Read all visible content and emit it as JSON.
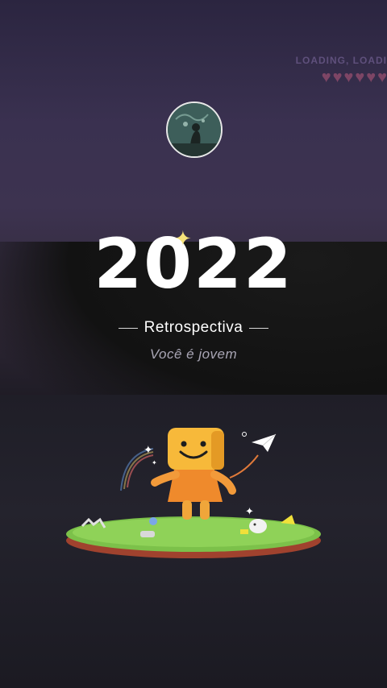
{
  "header": {
    "loading_text": "LOADING, LOADI",
    "hearts": [
      "♥",
      "♥",
      "♥",
      "♥",
      "♥",
      "♥"
    ]
  },
  "hero": {
    "year": "2022",
    "title": "Retrospectiva",
    "tagline": "Você é jovem"
  },
  "icons": {
    "avatar": "profile-avatar",
    "sparkle": "sparkle-icon",
    "mascot": "mascot-illustration",
    "paper_plane": "paper-plane-icon"
  },
  "colors": {
    "background": "#2a2238",
    "title": "#ffffff",
    "tagline": "#a9a6b5",
    "sparkle": "#f6e27a",
    "mascot": "#f7b93a"
  }
}
